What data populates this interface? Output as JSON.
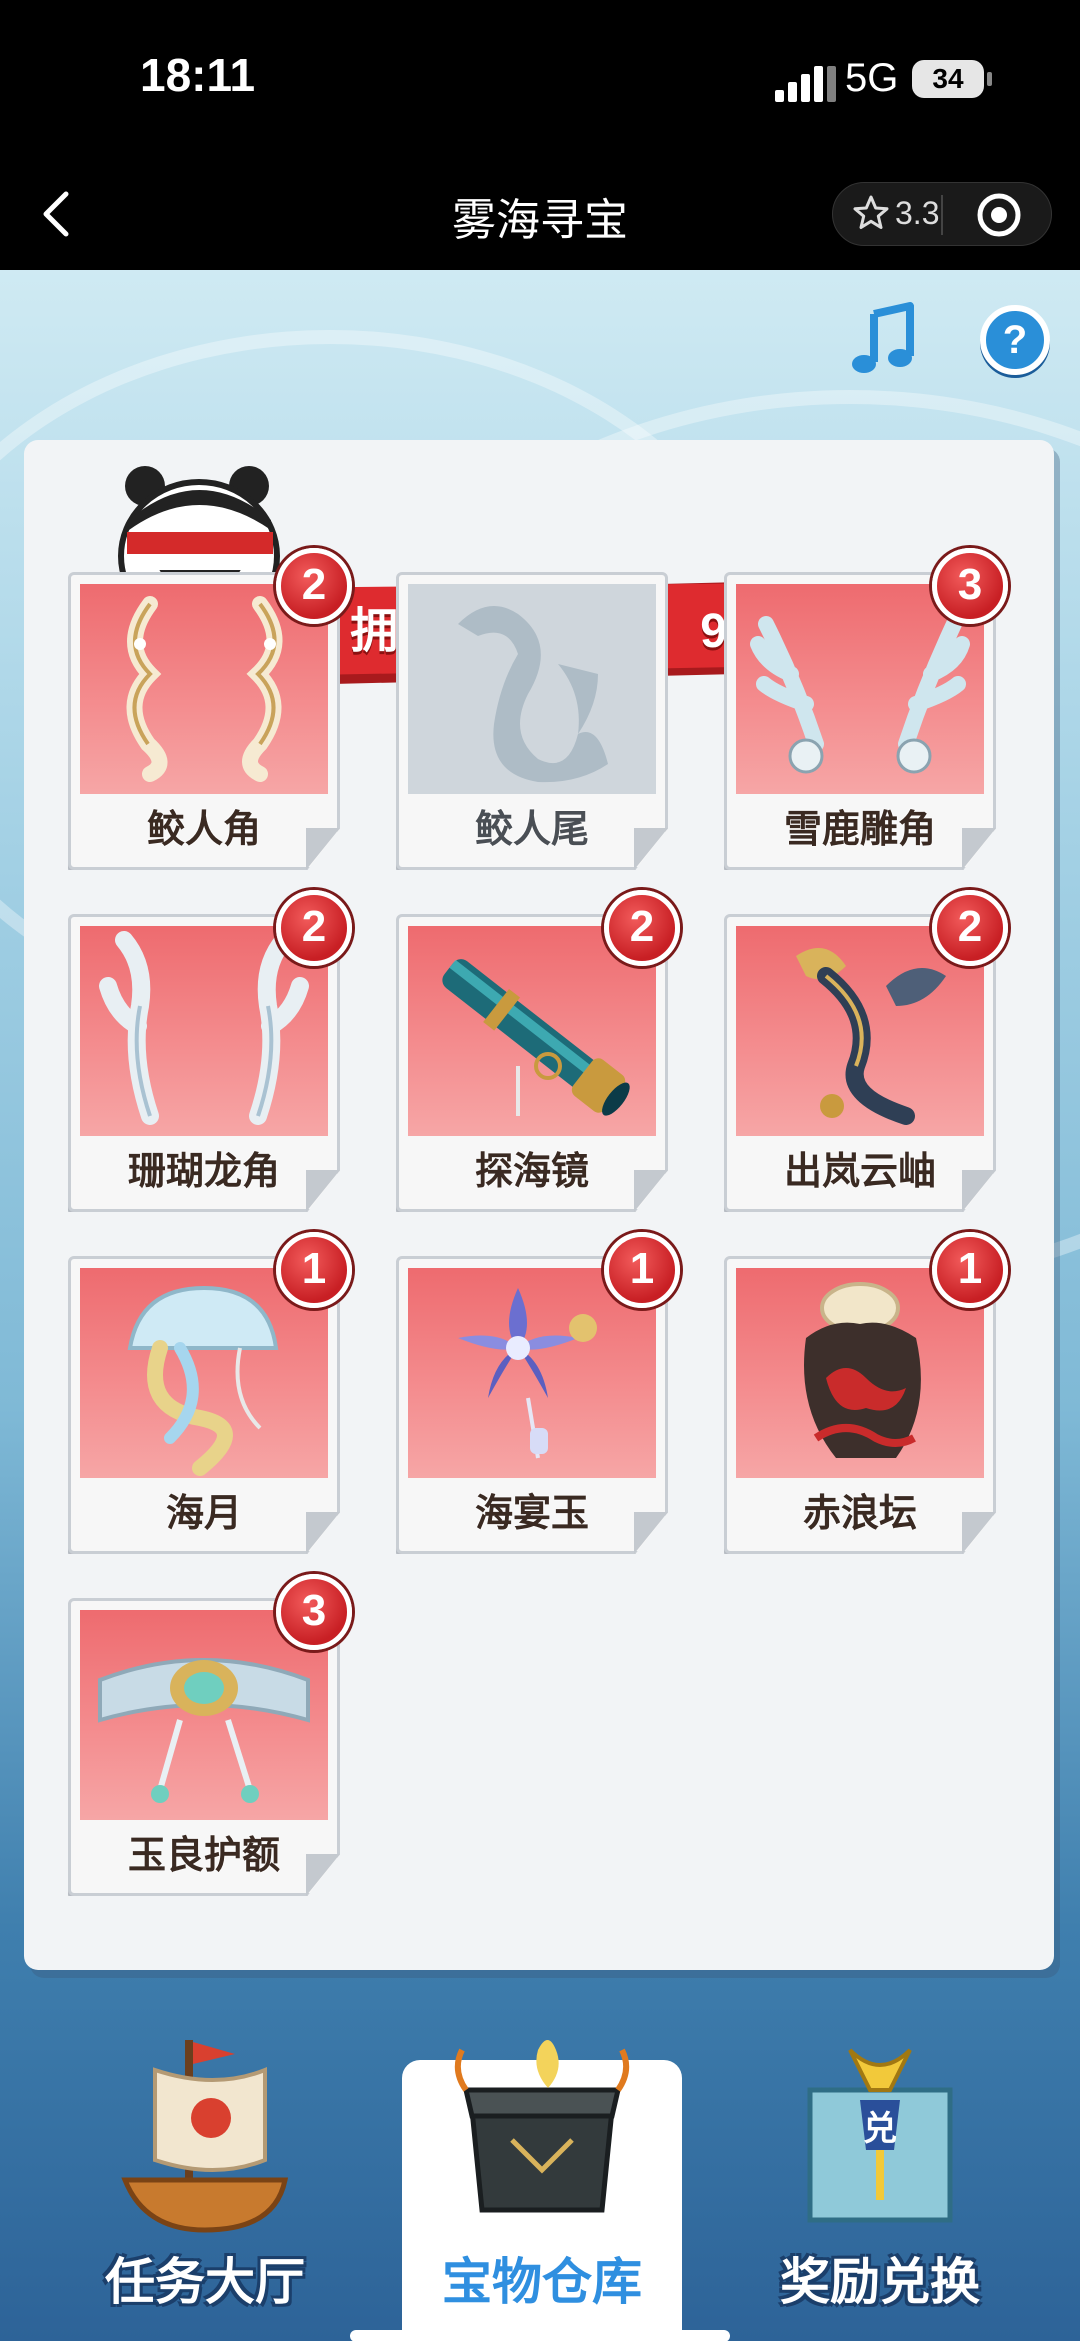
{
  "status_bar": {
    "time": "18:11",
    "network": "5G",
    "battery": "34"
  },
  "nav": {
    "title": "雾海寻宝",
    "rating": "3.3"
  },
  "banner": {
    "text": "拥有宝物种类：9/10"
  },
  "items": [
    {
      "name": "鲛人角",
      "count": "2",
      "owned": true,
      "icon": "coral-horns-gold-icon"
    },
    {
      "name": "鲛人尾",
      "count": "",
      "owned": false,
      "icon": "mermaid-tail-silhouette-icon"
    },
    {
      "name": "雪鹿雕角",
      "count": "3",
      "owned": true,
      "icon": "snow-deer-antlers-icon"
    },
    {
      "name": "珊瑚龙角",
      "count": "2",
      "owned": true,
      "icon": "coral-dragon-horns-icon"
    },
    {
      "name": "探海镜",
      "count": "2",
      "owned": true,
      "icon": "telescope-icon"
    },
    {
      "name": "出岚云岫",
      "count": "2",
      "owned": true,
      "icon": "cloud-staff-icon"
    },
    {
      "name": "海月",
      "count": "1",
      "owned": true,
      "icon": "jellyfish-icon"
    },
    {
      "name": "海宴玉",
      "count": "1",
      "owned": true,
      "icon": "flower-jade-pendant-icon"
    },
    {
      "name": "赤浪坛",
      "count": "1",
      "owned": true,
      "icon": "red-wave-jar-icon"
    },
    {
      "name": "玉良护额",
      "count": "3",
      "owned": true,
      "icon": "jade-headband-icon"
    }
  ],
  "bottom_nav": [
    {
      "label": "任务大厅",
      "icon": "ship-icon",
      "active": false
    },
    {
      "label": "宝物仓库",
      "icon": "treasure-chest-icon",
      "active": true
    },
    {
      "label": "奖励兑换",
      "icon": "gift-box-icon",
      "active": false
    }
  ],
  "colors": {
    "banner_red": "#d9262b",
    "card_red": "#ee6b6f",
    "active_tab_blue": "#2f8fe0"
  }
}
